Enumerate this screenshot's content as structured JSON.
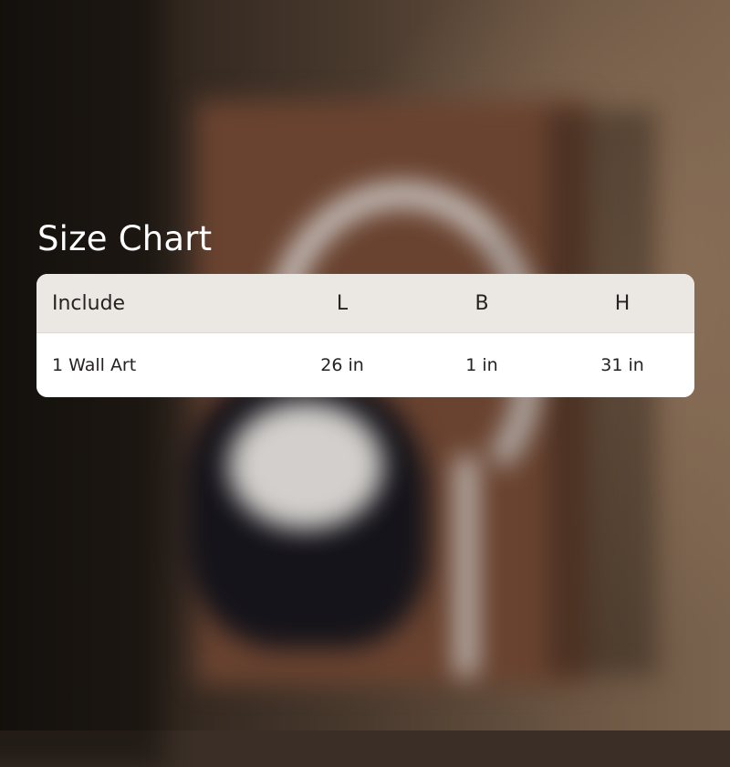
{
  "title": "Size Chart",
  "table": {
    "headers": [
      "Include",
      "L",
      "B",
      "H"
    ],
    "rows": [
      [
        "1 Wall Art",
        "26 in",
        "1 in",
        "31 in"
      ]
    ]
  },
  "colors": {
    "header_bg": "#ebe8e4",
    "row_bg": "#ffffff",
    "text": "#262220",
    "title": "#ffffff"
  }
}
